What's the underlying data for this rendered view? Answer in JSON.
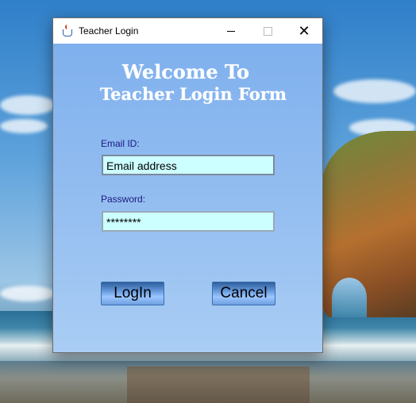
{
  "window": {
    "title": "Teacher Login",
    "icon": "java-cup-icon"
  },
  "form": {
    "heading_line1": "Welcome To",
    "heading_line2": "Teacher Login Form",
    "email_label": "Email ID:",
    "email_value": "Email address",
    "password_label": "Password:",
    "password_value": "********",
    "login_button": "LogIn",
    "cancel_button": "Cancel"
  },
  "controls": {
    "minimize": "minimize-icon",
    "maximize": "maximize-icon",
    "close": "close-icon"
  },
  "colors": {
    "form_background": "#91bcf0",
    "field_background": "#ccffff",
    "heading_text": "#ffffff",
    "label_text": "#1a1a80"
  }
}
